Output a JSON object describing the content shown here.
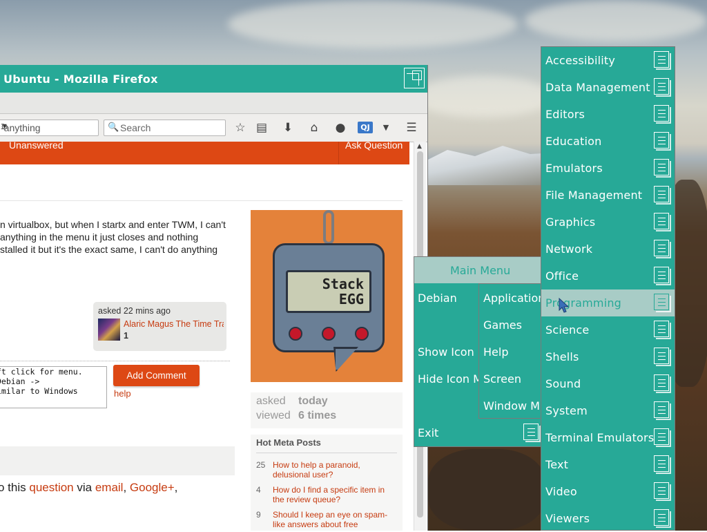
{
  "firefox": {
    "title": "Ubuntu - Mozilla Firefox",
    "url_fragment": "-anything",
    "search_placeholder": "Search",
    "qj_badge": "QJ"
  },
  "site_nav": {
    "unanswered": "Unanswered",
    "ask_question": "Ask Question"
  },
  "question": {
    "lines": [
      "n virtualbox, but when I startx and enter TWM, I can't",
      "anything in the menu it just closes and nothing",
      "stalled it but it's the exact same, I can't do anything"
    ],
    "asked_label": "asked 22 mins ago",
    "user_name": "Alaric Magus The Time Tra",
    "user_rep": "1"
  },
  "comment": {
    "lines": [
      "ft click for menu.",
      "Debian ->",
      "imilar to Windows"
    ],
    "add_button": "Add Comment",
    "help": "help"
  },
  "share": {
    "prefix": "o this ",
    "question": "question",
    "via": " via ",
    "email": "email",
    "sep": ", ",
    "google": "Google+",
    "tail": ","
  },
  "sidebar": {
    "egg_text_line1": "Stack",
    "egg_text_line2": "EGG",
    "asked_key": "asked",
    "asked_val": "today",
    "viewed_key": "viewed",
    "viewed_val": "6 times",
    "meta_heading": "Hot Meta Posts",
    "meta_posts": [
      {
        "count": "25",
        "title": "How to help a paranoid, delusional user?"
      },
      {
        "count": "4",
        "title": "How do I find a specific item in the review queue?"
      },
      {
        "count": "9",
        "title": "Should I keep an eye on spam-like answers about free"
      }
    ]
  },
  "twm_main_menu": {
    "title": "Main Menu",
    "items": [
      "Debian",
      "Show Icon",
      "Hide Icon M",
      "Exit"
    ]
  },
  "twm_submenu": {
    "items": [
      "Application",
      "Games",
      "Help",
      "Screen",
      "Window M"
    ]
  },
  "twm_apps_menu": {
    "highlighted": "Programming",
    "items": [
      "Accessibility",
      "Data Management",
      "Editors",
      "Education",
      "Emulators",
      "File Management",
      "Graphics",
      "Network",
      "Office",
      "Programming",
      "Science",
      "Shells",
      "Sound",
      "System",
      "Terminal Emulators",
      "Text",
      "Video",
      "Viewers"
    ]
  },
  "colors": {
    "twm_teal": "#27a997",
    "twm_highlight": "#a8ccc6",
    "stackexchange_orange": "#dd4814",
    "link_red": "#c63b10"
  }
}
